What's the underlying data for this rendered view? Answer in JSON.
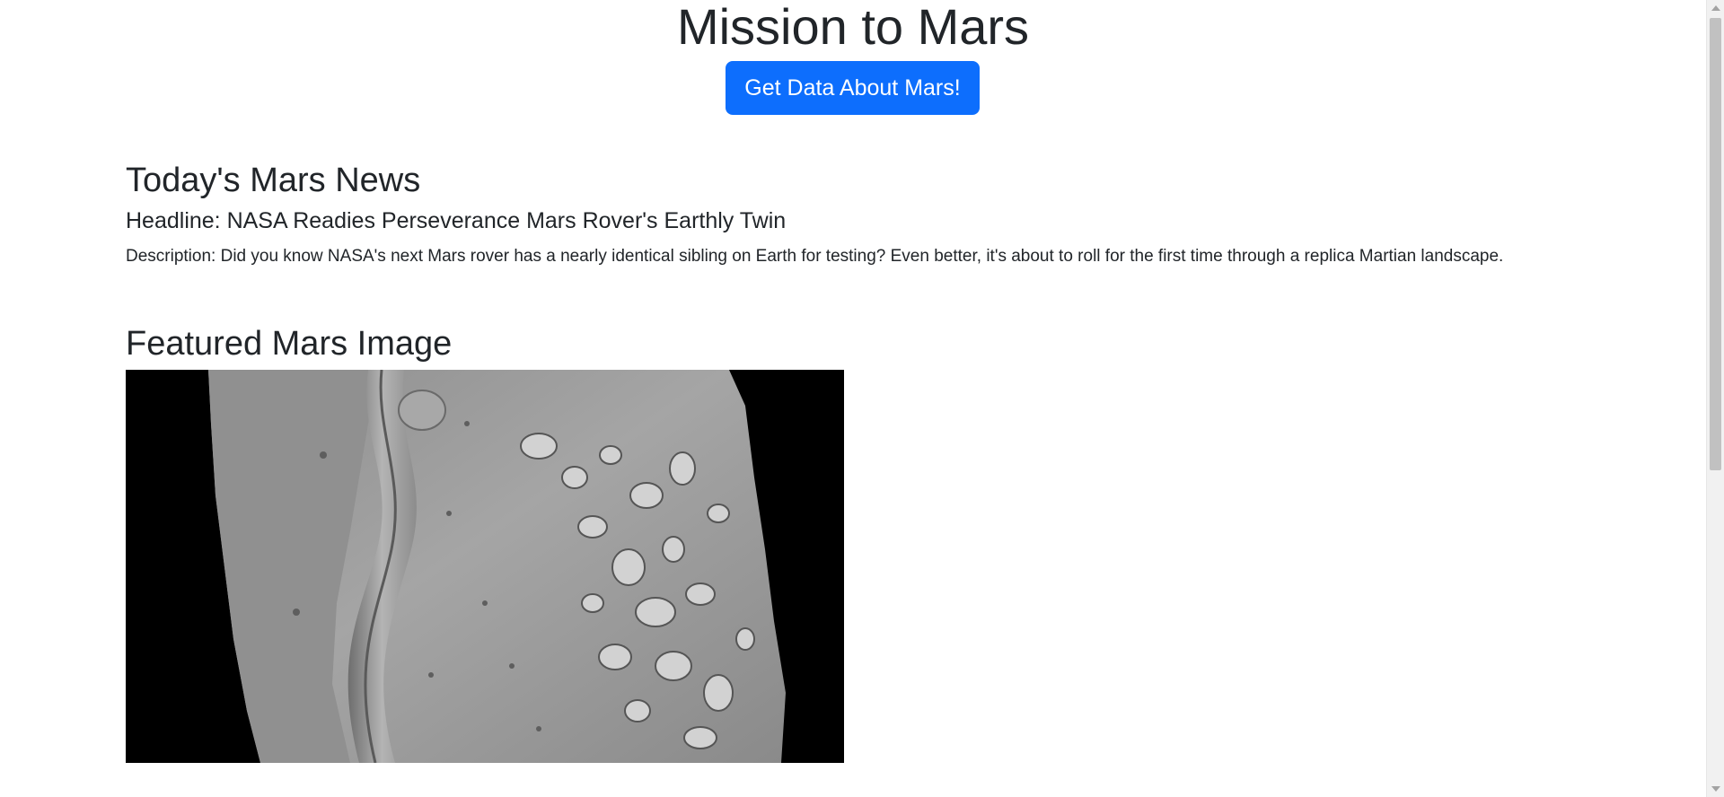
{
  "header": {
    "title": "Mission to Mars",
    "button_label": "Get Data About Mars!",
    "button_color": "#0d6efd"
  },
  "news": {
    "heading": "Today's Mars News",
    "headline": "Headline: NASA Readies Perseverance Mars Rover's Earthly Twin",
    "description": "Description: Did you know NASA's next Mars rover has a nearly identical sibling on Earth for testing? Even better, it's about to roll for the first time through a replica Martian landscape."
  },
  "featured_image": {
    "heading": "Featured Mars Image",
    "subject": "grayscale Mars surface strip with channel and mesas"
  },
  "scrollbar": {
    "icon_up": "chevron-up-icon",
    "icon_down": "chevron-down-icon"
  }
}
